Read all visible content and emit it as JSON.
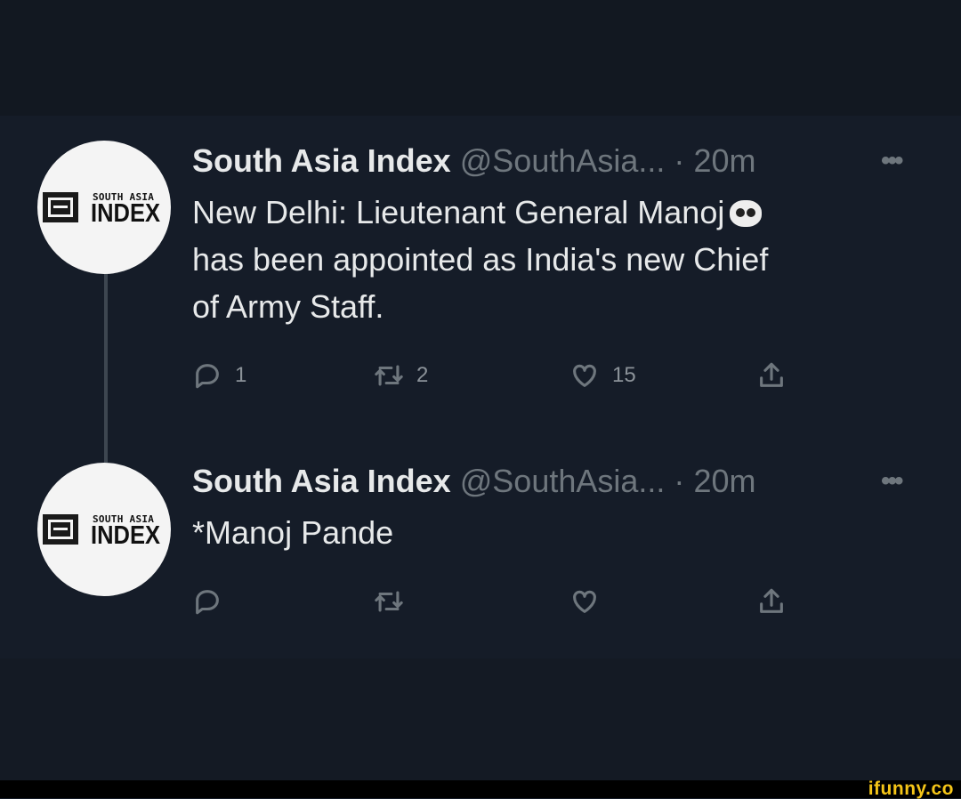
{
  "tweets": [
    {
      "name": "South Asia Index",
      "handle": "@SouthAsia...",
      "separator": "·",
      "time": "20m",
      "more": "•••",
      "avatar_small": "SOUTH ASIA",
      "avatar_big": "INDEX",
      "text_lines": [
        "New Delhi: Lieutenant General Manoj",
        "has been appointed as India's new Chief",
        "of Army Staff."
      ],
      "emoji": "panda-face-icon",
      "replies": "1",
      "retweets": "2",
      "likes": "15"
    },
    {
      "name": "South Asia Index",
      "handle": "@SouthAsia...",
      "separator": "·",
      "time": "20m",
      "more": "•••",
      "avatar_small": "SOUTH ASIA",
      "avatar_big": "INDEX",
      "text_lines": [
        "*Manoj Pande"
      ]
    }
  ],
  "watermark": "ifunny.co",
  "colors": {
    "background": "#141b26",
    "text": "#e7e9ea",
    "muted": "#6e767d",
    "watermark": "#f5c518"
  }
}
